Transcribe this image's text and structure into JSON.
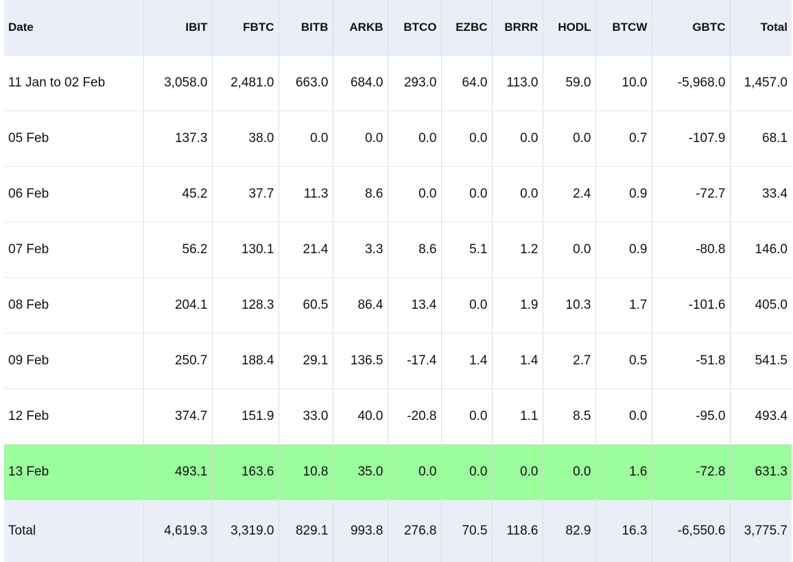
{
  "table": {
    "headers": [
      "Date",
      "IBIT",
      "FBTC",
      "BITB",
      "ARKB",
      "BTCO",
      "EZBC",
      "BRRR",
      "HODL",
      "BTCW",
      "GBTC",
      "Total"
    ],
    "rows": [
      {
        "cells": [
          "11 Jan to 02 Feb",
          "3,058.0",
          "2,481.0",
          "663.0",
          "684.0",
          "293.0",
          "64.0",
          "113.0",
          "59.0",
          "10.0",
          "-5,968.0",
          "1,457.0"
        ],
        "highlighted": false
      },
      {
        "cells": [
          "05 Feb",
          "137.3",
          "38.0",
          "0.0",
          "0.0",
          "0.0",
          "0.0",
          "0.0",
          "0.0",
          "0.7",
          "-107.9",
          "68.1"
        ],
        "highlighted": false
      },
      {
        "cells": [
          "06 Feb",
          "45.2",
          "37.7",
          "11.3",
          "8.6",
          "0.0",
          "0.0",
          "0.0",
          "2.4",
          "0.9",
          "-72.7",
          "33.4"
        ],
        "highlighted": false
      },
      {
        "cells": [
          "07 Feb",
          "56.2",
          "130.1",
          "21.4",
          "3.3",
          "8.6",
          "5.1",
          "1.2",
          "0.0",
          "0.9",
          "-80.8",
          "146.0"
        ],
        "highlighted": false
      },
      {
        "cells": [
          "08 Feb",
          "204.1",
          "128.3",
          "60.5",
          "86.4",
          "13.4",
          "0.0",
          "1.9",
          "10.3",
          "1.7",
          "-101.6",
          "405.0"
        ],
        "highlighted": false
      },
      {
        "cells": [
          "09 Feb",
          "250.7",
          "188.4",
          "29.1",
          "136.5",
          "-17.4",
          "1.4",
          "1.4",
          "2.7",
          "0.5",
          "-51.8",
          "541.5"
        ],
        "highlighted": false
      },
      {
        "cells": [
          "12 Feb",
          "374.7",
          "151.9",
          "33.0",
          "40.0",
          "-20.8",
          "0.0",
          "1.1",
          "8.5",
          "0.0",
          "-95.0",
          "493.4"
        ],
        "highlighted": false
      },
      {
        "cells": [
          "13 Feb",
          "493.1",
          "163.6",
          "10.8",
          "35.0",
          "0.0",
          "0.0",
          "0.0",
          "0.0",
          "1.6",
          "-72.8",
          "631.3"
        ],
        "highlighted": true
      }
    ],
    "total": [
      "Total",
      "4,619.3",
      "3,319.0",
      "829.1",
      "993.8",
      "276.8",
      "70.5",
      "118.6",
      "82.9",
      "16.3",
      "-6,550.6",
      "3,775.7"
    ]
  },
  "colors": {
    "header_background": "#e9eef9",
    "highlight_row": "#9bfd9b",
    "text": "#111111",
    "grid": "#dcdcdc"
  }
}
